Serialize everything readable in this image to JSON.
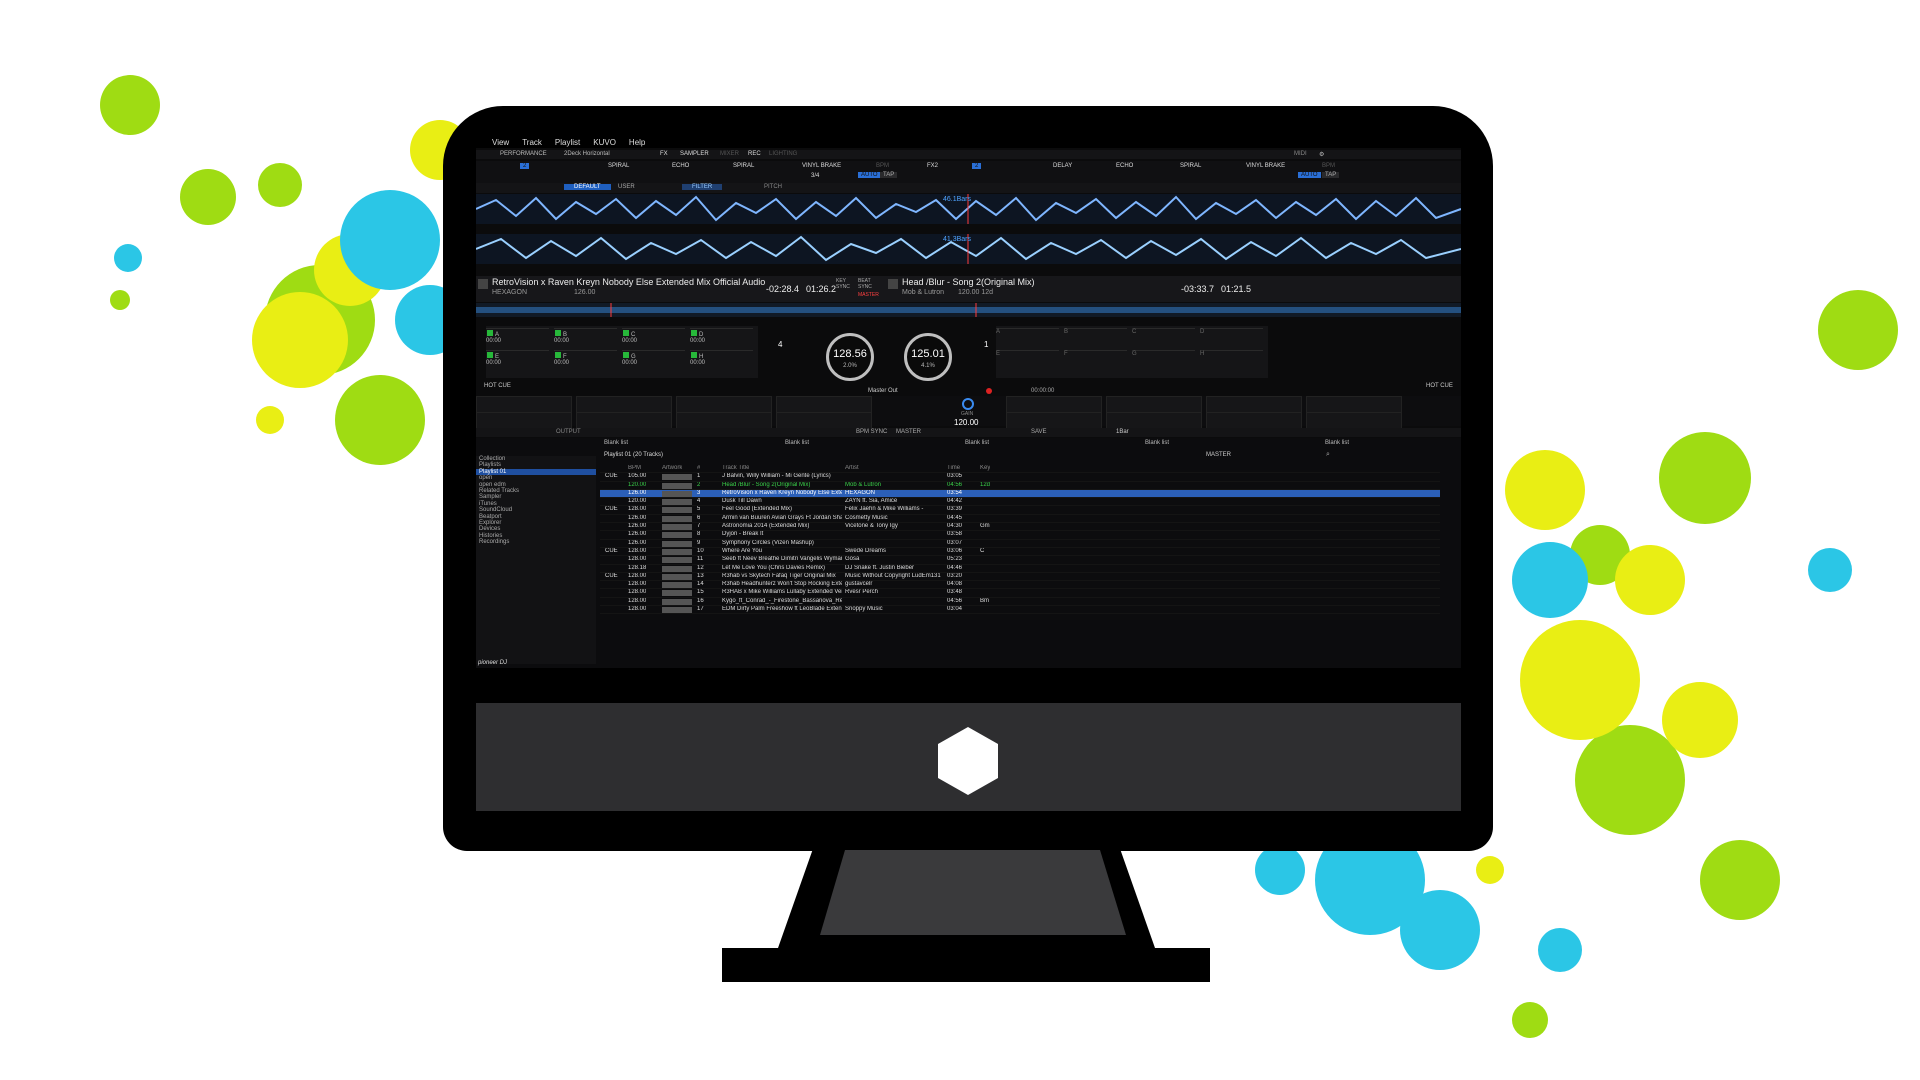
{
  "menu": [
    "View",
    "Track",
    "Playlist",
    "KUVO",
    "Help"
  ],
  "toolbar": {
    "mode": "PERFORMANCE",
    "layout": "2Deck Horizontal",
    "fx": "FX",
    "sampler": "SAMPLER",
    "mixer": "MIXER",
    "rec": "REC",
    "lighting": "LIGHTING",
    "midi": "MIDI"
  },
  "fx_left": {
    "effects": [
      "SPIRAL",
      "ECHO",
      "SPIRAL",
      "VINYL BRAKE"
    ],
    "bpm_label": "BPM",
    "auto": "AUTO",
    "tap": "TAP",
    "beat": "3/4"
  },
  "fx_right": {
    "name": "FX2",
    "effects": [
      "DELAY",
      "ECHO",
      "SPIRAL",
      "VINYL BRAKE"
    ],
    "bpm_label": "BPM",
    "auto": "AUTO",
    "tap": "TAP"
  },
  "hotcue_bar": {
    "default": "DEFAULT",
    "user": "USER",
    "filter": "FILTER",
    "pitch": "PITCH"
  },
  "waveform": {
    "bars_top": "46.1Bars",
    "bars_bottom": "41.3Bars"
  },
  "deck1": {
    "title": "RetroVision x Raven  Kreyn  Nobody Else Extended Mix Official Audio",
    "artist": "HEXAGON",
    "bpm_small": "126.00",
    "remain": "-02:28.4",
    "elapsed": "01:26.2",
    "bpm": "128.56",
    "pitch": "2.0%",
    "key_sync": "KEY SYNC",
    "beat_sync": "BEAT SYNC",
    "master": "MASTER",
    "beat_jump": "4",
    "hot_cue": "HOT CUE",
    "pad_labels": [
      "A",
      "B",
      "C",
      "D",
      "E",
      "F",
      "G",
      "H"
    ],
    "pad_times": [
      "00:00",
      "00:00",
      "00:00",
      "00:00",
      "00:00",
      "00:00",
      "00:00",
      "00:00"
    ]
  },
  "deck2": {
    "title": "Head /Blur - Song 2(Original Mix)",
    "artist": "Mob & Lutron",
    "bpm_small": "120.00  12d",
    "remain": "-03:33.7",
    "elapsed": "01:21.5",
    "bpm": "125.01",
    "pitch": "4.1%",
    "beat_jump": "1",
    "hot_cue": "HOT CUE",
    "pad_labels": [
      "A",
      "B",
      "C",
      "D",
      "E",
      "F",
      "G",
      "H"
    ]
  },
  "master_out": "Master Out",
  "rec_time": "00:00:00",
  "sampler": {
    "gain": "GAIN",
    "bpm": "120.00",
    "output": "OUTPUT",
    "bpm_sync": "BPM SYNC",
    "master": "MASTER",
    "save": "SAVE",
    "bar": "1Bar"
  },
  "browser": {
    "tabs": [
      "Blank list",
      "Blank list",
      "Blank list",
      "Blank list",
      "Blank list"
    ],
    "playlist_header": "Playlist 01 (20 Tracks)",
    "master_btn": "MASTER",
    "tree": [
      "Collection",
      "Playlists",
      "Playlist 01",
      "open",
      "open edm",
      "Related Tracks",
      "Sampler",
      "iTunes",
      "SoundCloud",
      "Beatport",
      "Explorer",
      "Devices",
      "Histories",
      "Recordings"
    ],
    "columns": [
      "BPM",
      "Artwork",
      "#",
      "Track Title",
      "Artist",
      "Time",
      "Key"
    ],
    "rows": [
      {
        "cue": "CUE",
        "bpm": "105.00",
        "no": "1",
        "title": "J Balvin, Willy William - Mi Gente (Lyrics)",
        "artist": "",
        "time": "03:05",
        "key": "",
        "state": "normal"
      },
      {
        "cue": "",
        "bpm": "120.00",
        "no": "2",
        "title": "Head /Blur - Song 2(Original Mix)",
        "artist": "Mob & Lutron",
        "time": "04:56",
        "key": "12d",
        "state": "current"
      },
      {
        "cue": "",
        "bpm": "126.00",
        "no": "3",
        "title": "RetroVision x Raven  Kreyn  Nobody Else Extended Mix",
        "artist": "HEXAGON",
        "time": "03:54",
        "key": "",
        "state": "selected"
      },
      {
        "cue": "",
        "bpm": "120.00",
        "no": "4",
        "title": "Dusk Till Dawn",
        "artist": "ZAYN ft. Sia, Amice",
        "time": "04:42",
        "key": "",
        "state": "normal"
      },
      {
        "cue": "CUE",
        "bpm": "128.00",
        "no": "5",
        "title": "Feel Good (Extended Mix)",
        "artist": "Felix Jaehn & Mike Williams -",
        "time": "03:39",
        "key": "",
        "state": "normal"
      },
      {
        "cue": "",
        "bpm": "126.00",
        "no": "6",
        "title": "Armin van Buuren  Avian Grays Ft Jordan Shaw  Somethi",
        "artist": "Cosmetty Music",
        "time": "04:45",
        "key": "",
        "state": "normal"
      },
      {
        "cue": "",
        "bpm": "126.00",
        "no": "7",
        "title": "Astronomia 2014 (Extended Mix)",
        "artist": "Vicetone & Tony Igy",
        "time": "04:30",
        "key": "Gm",
        "state": "normal"
      },
      {
        "cue": "",
        "bpm": "126.00",
        "no": "8",
        "title": "Dyjon - Break It",
        "artist": "",
        "time": "03:58",
        "key": "",
        "state": "normal"
      },
      {
        "cue": "",
        "bpm": "126.00",
        "no": "9",
        "title": "Symphony Circles (Vizen Mashup)",
        "artist": "",
        "time": "03:07",
        "key": "",
        "state": "normal"
      },
      {
        "cue": "CUE",
        "bpm": "128.00",
        "no": "10",
        "title": "Where Are You",
        "artist": "Swede Dreams",
        "time": "03:06",
        "key": "C",
        "state": "normal"
      },
      {
        "cue": "",
        "bpm": "128.00",
        "no": "11",
        "title": "Seeb ft Neev  Breathe Dimitri Vangelis  Wyman Remix8A",
        "artist": "Gosa",
        "time": "05:23",
        "key": "",
        "state": "normal"
      },
      {
        "cue": "",
        "bpm": "128.18",
        "no": "12",
        "title": "Let Me Love You (Chris Davies Remix)",
        "artist": "DJ Snake ft. Justin Bieber",
        "time": "04:46",
        "key": "",
        "state": "normal"
      },
      {
        "cue": "CUE",
        "bpm": "128.00",
        "no": "13",
        "title": "R3hab vs Skytech  Fafaq  Tiger Original Mix",
        "artist": "Music Without Copyright  LudEm131",
        "time": "03:20",
        "key": "",
        "state": "normal"
      },
      {
        "cue": "",
        "bpm": "128.00",
        "no": "14",
        "title": "R3hab  Headhunterz Won't Stop Rocking Extended Mix",
        "artist": "gustavcelr",
        "time": "04:08",
        "key": "",
        "state": "normal"
      },
      {
        "cue": "",
        "bpm": "128.00",
        "no": "15",
        "title": "R3HAB x Mike Williams Lullaby Extended Version",
        "artist": "Rvesr Perch",
        "time": "03:48",
        "key": "",
        "state": "normal"
      },
      {
        "cue": "",
        "bpm": "128.00",
        "no": "16",
        "title": "Kygo_ft_Conrad_-_Firestone_Bassanova_Remix_FREE]",
        "artist": "",
        "time": "04:56",
        "key": "Bm",
        "state": "normal"
      },
      {
        "cue": "",
        "bpm": "128.00",
        "no": "17",
        "title": "EDM  Dirty Palm  Freeshow ft LeoBlade Extended Mix",
        "artist": "Snoppy Music",
        "time": "03:04",
        "key": "",
        "state": "normal"
      }
    ]
  },
  "brand": "pioneer DJ",
  "colors": {
    "splash_green": "#9fdc13",
    "splash_yellow": "#e9ee14",
    "splash_cyan": "#2bc6e6",
    "accent_blue": "#2a6fd6",
    "current_green": "#3bd14a"
  }
}
